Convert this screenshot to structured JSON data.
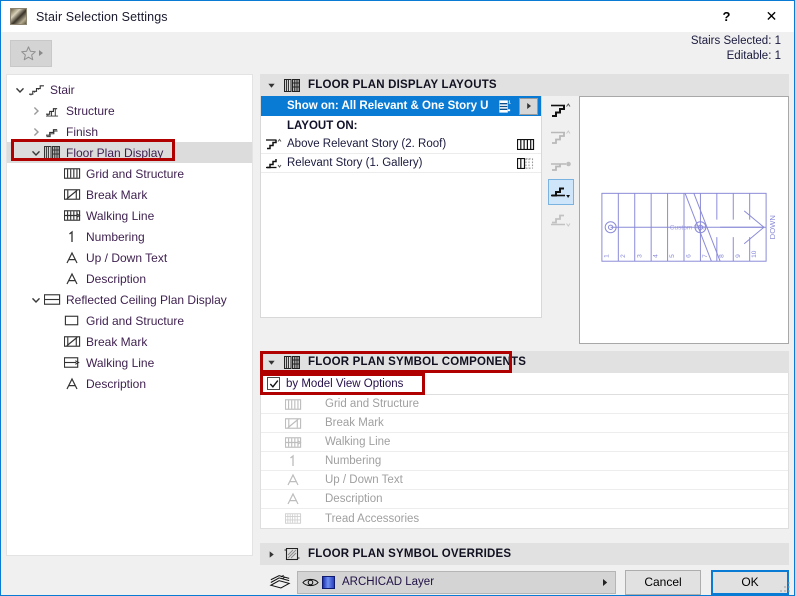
{
  "window": {
    "title": "Stair Selection Settings",
    "app_icon": "stair-app-icon",
    "help_label": "?",
    "close_label": "✕"
  },
  "toolbar": {
    "favorites_icon": "star-icon",
    "favorites_arrow": "chevron-right-icon",
    "stairs_selected": "Stairs Selected: 1",
    "editable": "Editable: 1"
  },
  "sidebar": {
    "items": [
      {
        "label": "Stair",
        "level": 0,
        "twist": "expanded",
        "icon": "stair-icon",
        "selected": false
      },
      {
        "label": "Structure",
        "level": 1,
        "twist": "collapsed",
        "icon": "structure-icon",
        "selected": false
      },
      {
        "label": "Finish",
        "level": 1,
        "twist": "collapsed",
        "icon": "finish-icon",
        "selected": false
      },
      {
        "label": "Floor Plan Display",
        "level": 1,
        "twist": "expanded",
        "icon": "floor-plan-icon",
        "selected": true
      },
      {
        "label": "Grid and Structure",
        "level": 2,
        "twist": "none",
        "icon": "grid-structure-icon",
        "selected": false
      },
      {
        "label": "Break Mark",
        "level": 2,
        "twist": "none",
        "icon": "break-mark-icon",
        "selected": false
      },
      {
        "label": "Walking Line",
        "level": 2,
        "twist": "none",
        "icon": "walking-line-icon",
        "selected": false
      },
      {
        "label": "Numbering",
        "level": 2,
        "twist": "none",
        "icon": "numbering-icon",
        "selected": false
      },
      {
        "label": "Up / Down Text",
        "level": 2,
        "twist": "none",
        "icon": "text-icon",
        "selected": false
      },
      {
        "label": "Description",
        "level": 2,
        "twist": "none",
        "icon": "text-icon",
        "selected": false
      },
      {
        "label": "Reflected Ceiling Plan Display",
        "level": 1,
        "twist": "expanded",
        "icon": "rcp-icon",
        "selected": false
      },
      {
        "label": "Grid and Structure",
        "level": 2,
        "twist": "none",
        "icon": "rcp-grid-icon",
        "selected": false
      },
      {
        "label": "Break Mark",
        "level": 2,
        "twist": "none",
        "icon": "break-mark-icon",
        "selected": false
      },
      {
        "label": "Walking Line",
        "level": 2,
        "twist": "none",
        "icon": "rcp-walking-icon",
        "selected": false
      },
      {
        "label": "Description",
        "level": 2,
        "twist": "none",
        "icon": "text-icon",
        "selected": false
      }
    ]
  },
  "layouts_panel": {
    "header": "FLOOR PLAN DISPLAY LAYOUTS",
    "header_icon": "floor-plan-icon",
    "show_on": "Show on: All Relevant & One Story Up",
    "show_on_icon": "story-stack-icon",
    "show_on_button_icon": "chevron-right-icon",
    "layout_on_label": "LAYOUT ON:",
    "rows": [
      {
        "icon": "stair-up-icon",
        "label": "Above Relevant Story (2. Roof)",
        "right_icon": "grid-solid-icon"
      },
      {
        "icon": "stair-down-icon",
        "label": "Relevant Story (1. Gallery)",
        "right_icon": "grid-dashed-icon"
      }
    ]
  },
  "representation_icons": [
    {
      "name": "rep-full-icon",
      "active": false
    },
    {
      "name": "rep-above-icon",
      "active": false
    },
    {
      "name": "rep-dot-icon",
      "active": false
    },
    {
      "name": "rep-relevant-icon",
      "active": true
    },
    {
      "name": "rep-below-icon",
      "active": false
    }
  ],
  "preview": {
    "name": "stair-plan-preview",
    "down_text": "DOWN",
    "center_text": "Custom Text",
    "tread_numbers": [
      "1",
      "2",
      "3",
      "4",
      "5",
      "6",
      "7",
      "8",
      "9",
      "10"
    ],
    "line_color": "#8a8ad8"
  },
  "components_panel": {
    "header": "FLOOR PLAN SYMBOL COMPONENTS",
    "header_icon": "floor-plan-icon",
    "by_model_view_options": "by Model View Options",
    "checkbox_checked": true,
    "rows": [
      {
        "icon": "grid-structure-icon",
        "label": "Grid and Structure"
      },
      {
        "icon": "break-mark-icon",
        "label": "Break Mark"
      },
      {
        "icon": "walking-line-icon",
        "label": "Walking Line"
      },
      {
        "icon": "numbering-icon",
        "label": "Numbering"
      },
      {
        "icon": "text-icon",
        "label": "Up / Down Text"
      },
      {
        "icon": "text-icon",
        "label": "Description"
      },
      {
        "icon": "tread-accessories-icon",
        "label": "Tread Accessories"
      }
    ]
  },
  "overrides_panel": {
    "header": "FLOOR PLAN SYMBOL OVERRIDES",
    "header_icon": "overrides-icon",
    "expanded": false
  },
  "footer": {
    "layer_icon": "layers-icon",
    "eye_icon": "eye-icon",
    "layer_swatch": "layer-color-swatch",
    "layer_value": "ARCHICAD Layer",
    "layer_arrow": "chevron-right-icon",
    "cancel_label": "Cancel",
    "ok_label": "OK"
  },
  "annotations": {
    "color": "#b00000",
    "boxes": [
      "floor-plan-display-tree-item",
      "floor-plan-symbol-components-header",
      "by-model-view-options-checkbox"
    ]
  },
  "colors": {
    "accent": "#0a7bd4",
    "selection_blue": "#0a7bd4",
    "tree_selected": "#dcdcdc",
    "section_header": "#e1e1e1",
    "text_purple": "#3d1f4e",
    "annotation_red": "#b00000",
    "disabled_gray": "#a0a0a0"
  }
}
